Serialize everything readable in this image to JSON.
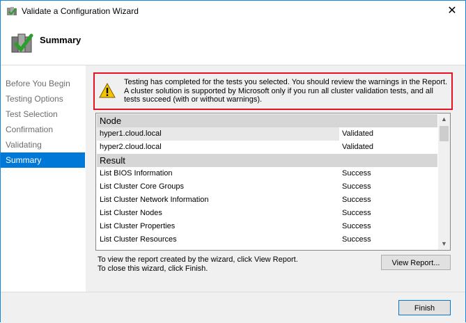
{
  "window": {
    "title": "Validate a Configuration Wizard",
    "close_glyph": "✕"
  },
  "header": {
    "title": "Summary"
  },
  "nav": {
    "items": [
      {
        "label": "Before You Begin"
      },
      {
        "label": "Testing Options"
      },
      {
        "label": "Test Selection"
      },
      {
        "label": "Confirmation"
      },
      {
        "label": "Validating"
      },
      {
        "label": "Summary"
      }
    ],
    "active": "Summary"
  },
  "warning": {
    "text": "Testing has completed for the tests you selected. You should review the warnings in the Report.  A cluster solution is supported by Microsoft only if you run all cluster validation tests, and all tests succeed (with or without warnings)."
  },
  "report": {
    "node_header": "Node",
    "nodes": [
      {
        "name": "hyper1.cloud.local",
        "status": "Validated"
      },
      {
        "name": "hyper2.cloud.local",
        "status": "Validated"
      }
    ],
    "result_header": "Result",
    "results": [
      {
        "name": "List BIOS Information",
        "status": "Success"
      },
      {
        "name": "List Cluster Core Groups",
        "status": "Success"
      },
      {
        "name": "List Cluster Network Information",
        "status": "Success"
      },
      {
        "name": "List Cluster Nodes",
        "status": "Success"
      },
      {
        "name": "List Cluster Properties",
        "status": "Success"
      },
      {
        "name": "List Cluster Resources",
        "status": "Success"
      }
    ]
  },
  "info": {
    "line1": "To view the report created by the wizard, click View Report.",
    "line2": "To close this wizard, click Finish."
  },
  "buttons": {
    "view_report": "View Report...",
    "finish": "Finish"
  },
  "colors": {
    "accent": "#0078d7",
    "warning_border": "#e81123"
  }
}
